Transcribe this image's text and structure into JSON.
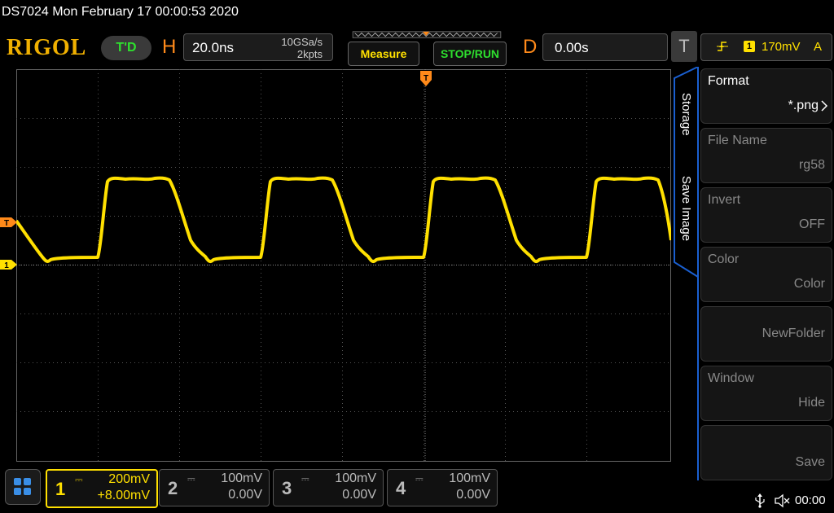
{
  "status": {
    "text": "DS7024  Mon February 17 00:00:53 2020"
  },
  "brand": {
    "logo": "RIGOL",
    "td_badge": "T'D"
  },
  "horizontal": {
    "letter": "H",
    "timebase": "20.0ns",
    "sample_rate": "10GSa/s",
    "memory_depth": "2kpts"
  },
  "buttons": {
    "measure": "Measure",
    "stop_run": "STOP/RUN"
  },
  "delay": {
    "letter": "D",
    "value": "0.00s"
  },
  "trigger": {
    "letter": "T",
    "source": "1",
    "level": "170mV",
    "mode": "A"
  },
  "markers": {
    "trigger_level": "T",
    "channel1": "1",
    "trigger_position": "T"
  },
  "side_menu": {
    "tabs": [
      "Storage",
      "Save Image"
    ],
    "items": [
      {
        "label": "Format",
        "value": "*.png",
        "state": "enabled"
      },
      {
        "label": "File Name",
        "value": "rg58",
        "state": "disabled"
      },
      {
        "label": "Invert",
        "value": "OFF",
        "state": "disabled"
      },
      {
        "label": "Color",
        "value": "Color",
        "state": "disabled"
      },
      {
        "label": "",
        "value": "NewFolder",
        "state": "disabled"
      },
      {
        "label": "Window",
        "value": "Hide",
        "state": "disabled"
      },
      {
        "label": "",
        "value": "Save",
        "state": "disabled"
      }
    ]
  },
  "channels": [
    {
      "number": "1",
      "scale": "200mV",
      "offset": "+8.00mV",
      "active": true
    },
    {
      "number": "2",
      "scale": "100mV",
      "offset": "0.00V",
      "active": false
    },
    {
      "number": "3",
      "scale": "100mV",
      "offset": "0.00V",
      "active": false
    },
    {
      "number": "4",
      "scale": "100mV",
      "offset": "0.00V",
      "active": false
    }
  ],
  "system": {
    "time": "00:00"
  },
  "colors": {
    "channel1": "#ffe000",
    "horizontal": "#ff8a1a",
    "run_state": "#2ee02e",
    "menu_border": "#1a5fd0"
  },
  "icons": {
    "home": "grid-icon",
    "usb": "usb-icon",
    "sound": "mute-icon",
    "trigger_edge": "rising-edge-icon"
  }
}
